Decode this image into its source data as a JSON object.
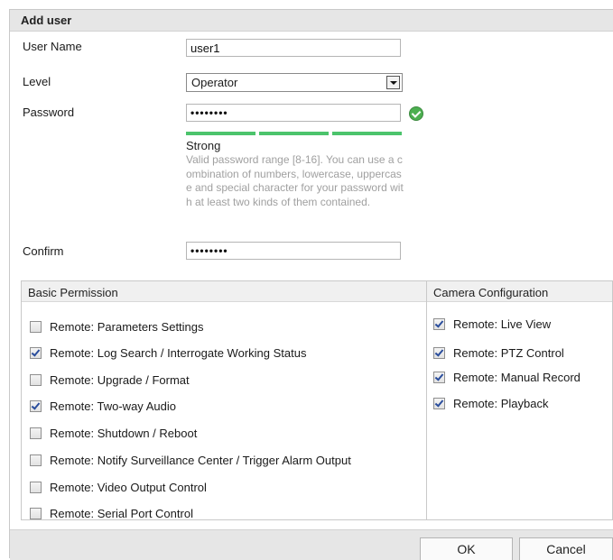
{
  "dialog": {
    "title": "Add user"
  },
  "form": {
    "user_name_label": "User Name",
    "user_name_value": "user1",
    "level_label": "Level",
    "level_value": "Operator",
    "password_label": "Password",
    "password_value": "••••••••",
    "password_strength": "Strong",
    "password_strength_segments_filled": 3,
    "password_strength_segments_total": 3,
    "password_hint": "Valid password range [8-16]. You can use a combination of numbers, lowercase, uppercase and special character for your password with at least two kinds of them contained.",
    "confirm_label": "Confirm",
    "confirm_value": "••••••••"
  },
  "basic_permission": {
    "header": "Basic Permission",
    "items": [
      {
        "label": "Remote: Parameters Settings",
        "checked": false
      },
      {
        "label": "Remote: Log Search / Interrogate Working Status",
        "checked": true
      },
      {
        "label": "Remote: Upgrade / Format",
        "checked": false
      },
      {
        "label": "Remote: Two-way Audio",
        "checked": true
      },
      {
        "label": "Remote: Shutdown / Reboot",
        "checked": false
      },
      {
        "label": "Remote: Notify Surveillance Center / Trigger Alarm Output",
        "checked": false
      },
      {
        "label": "Remote: Video Output Control",
        "checked": false
      },
      {
        "label": "Remote: Serial Port Control",
        "checked": false
      }
    ]
  },
  "camera_configuration": {
    "header": "Camera Configuration",
    "items": [
      {
        "label": "Remote: Live View",
        "checked": true
      },
      {
        "label": "Remote: PTZ Control",
        "checked": true
      },
      {
        "label": "Remote: Manual Record",
        "checked": true
      },
      {
        "label": "Remote: Playback",
        "checked": true
      }
    ]
  },
  "buttons": {
    "ok": "OK",
    "cancel": "Cancel"
  },
  "colors": {
    "strength_bar": "#4cc46c",
    "valid_icon": "#4caf50",
    "title_bar": "#e6e6e6"
  }
}
